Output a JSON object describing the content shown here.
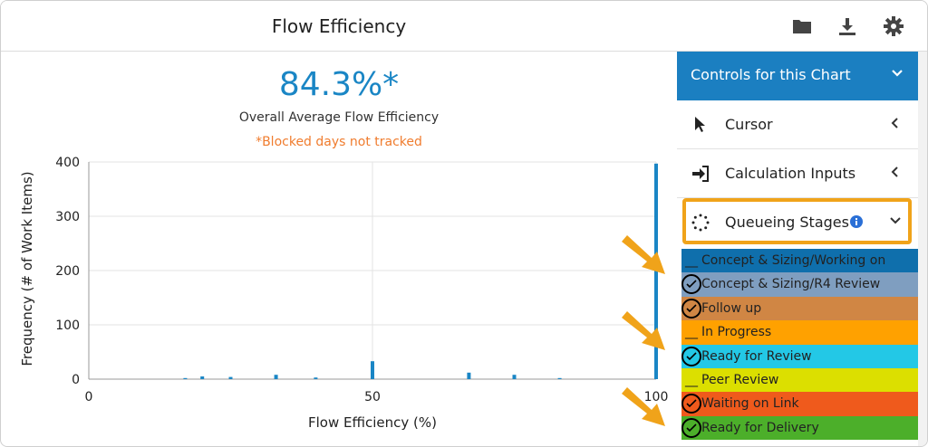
{
  "header": {
    "title": "Flow Efficiency",
    "icons": [
      "folder-icon",
      "download-icon",
      "gear-icon"
    ]
  },
  "summary": {
    "value": "84.3%*",
    "label": "Overall Average Flow Efficiency",
    "note": "*Blocked days not tracked"
  },
  "chart_data": {
    "type": "bar",
    "xlabel": "Flow Efficiency (%)",
    "ylabel": "Frequency (# of Work Items)",
    "xlim": [
      0,
      100
    ],
    "ylim": [
      0,
      400
    ],
    "x_ticks": [
      "0",
      "50",
      "100"
    ],
    "y_ticks": [
      "0",
      "100",
      "200",
      "300",
      "400"
    ],
    "grid": true,
    "accent_color": "#1a86c5",
    "points": [
      {
        "x": 17,
        "y": 2
      },
      {
        "x": 20,
        "y": 5
      },
      {
        "x": 25,
        "y": 4
      },
      {
        "x": 33,
        "y": 8
      },
      {
        "x": 40,
        "y": 3
      },
      {
        "x": 50,
        "y": 33
      },
      {
        "x": 67,
        "y": 12
      },
      {
        "x": 75,
        "y": 8
      },
      {
        "x": 83,
        "y": 2
      },
      {
        "x": 100,
        "y": 397
      }
    ]
  },
  "panel": {
    "header": "Controls for this Chart",
    "sections": [
      {
        "label": "Cursor",
        "icon": "cursor-icon"
      },
      {
        "label": "Calculation Inputs",
        "icon": "sign-in-icon"
      },
      {
        "label": "Queueing Stages",
        "icon": "spinner-icon"
      }
    ],
    "info_icon": "info-icon",
    "stages": [
      {
        "label": "Concept & Sizing/Working on",
        "checked": false,
        "color": "#0f6fac"
      },
      {
        "label": "Concept & Sizing/R4 Review",
        "checked": true,
        "color": "#7f9ec0"
      },
      {
        "label": "Follow up",
        "checked": true,
        "color": "#d08644"
      },
      {
        "label": "In Progress",
        "checked": false,
        "color": "#ffa100"
      },
      {
        "label": "Ready for Review",
        "checked": true,
        "color": "#23c8e6"
      },
      {
        "label": "Peer Review",
        "checked": false,
        "color": "#dcdf00"
      },
      {
        "label": "Waiting on Link",
        "checked": true,
        "color": "#ef5a1c"
      },
      {
        "label": "Ready for Delivery",
        "checked": true,
        "color": "#4caf2a"
      }
    ],
    "unchecked_mark": "__"
  },
  "colors": {
    "highlight": "#f0a31a",
    "panel_header": "#1b7fc1"
  }
}
